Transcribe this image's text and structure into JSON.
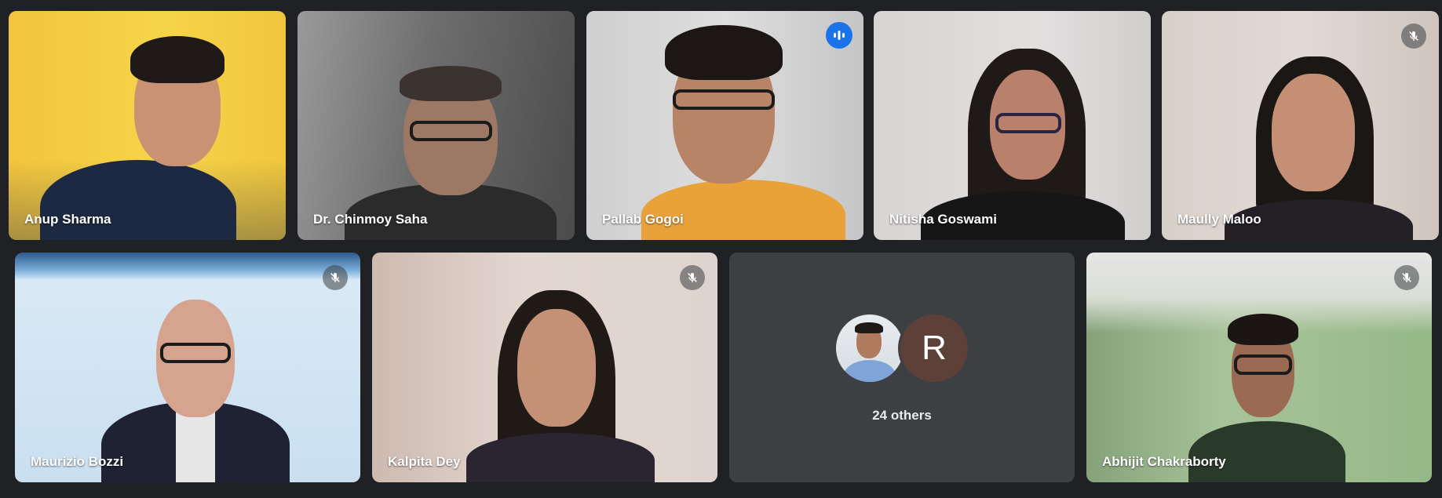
{
  "participants": [
    {
      "name": "Anup Sharma",
      "muted": false,
      "speaking": false
    },
    {
      "name": "Dr. Chinmoy Saha",
      "muted": false,
      "speaking": false
    },
    {
      "name": "Pallab Gogoi",
      "muted": false,
      "speaking": true
    },
    {
      "name": "Nitisha Goswami",
      "muted": false,
      "speaking": false
    },
    {
      "name": "Maully Maloo",
      "muted": true,
      "speaking": false
    },
    {
      "name": "Maurizio Bozzi",
      "muted": true,
      "speaking": false
    },
    {
      "name": "Kalpita Dey",
      "muted": true,
      "speaking": false
    },
    {
      "name": "Abhijit Chakraborty",
      "muted": true,
      "speaking": false
    }
  ],
  "others_tile": {
    "letter_avatar": "R",
    "label": "24 others"
  },
  "icons": {
    "mute": "mic-off-icon",
    "speaking": "audio-level-icon"
  },
  "colors": {
    "background": "#202124",
    "speaking_border": "#8ab4f8",
    "speaking_badge": "#1a73e8",
    "letter_avatar_bg": "#5d4037"
  }
}
